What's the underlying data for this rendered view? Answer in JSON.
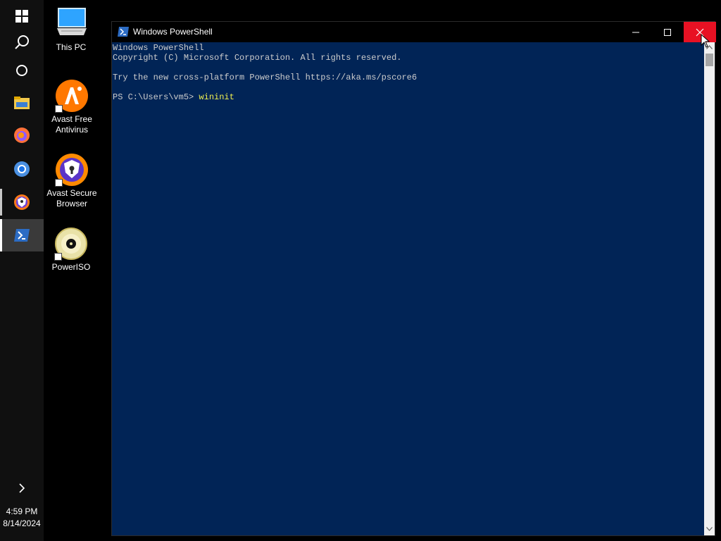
{
  "taskbar": {
    "items": [
      {
        "name": "start",
        "icon": "windows-logo-icon"
      },
      {
        "name": "search",
        "icon": "search-icon"
      },
      {
        "name": "cortana",
        "icon": "circle-icon"
      },
      {
        "name": "file-explorer",
        "icon": "folder-icon"
      },
      {
        "name": "firefox",
        "icon": "firefox-icon"
      },
      {
        "name": "chrome",
        "icon": "chrome-icon"
      },
      {
        "name": "avast-secure-browser",
        "icon": "avast-browser-icon"
      },
      {
        "name": "powershell",
        "icon": "powershell-icon"
      }
    ],
    "show_more_icon": "chevron-right-icon",
    "time": "4:59 PM",
    "date": "8/14/2024"
  },
  "desktop": {
    "icons": [
      {
        "label": "This PC",
        "icon": "computer-icon"
      },
      {
        "label": "Avast Free Antivirus",
        "icon": "avast-antivirus-icon"
      },
      {
        "label": "Avast Secure Browser",
        "icon": "avast-secure-browser-icon"
      },
      {
        "label": "PowerISO",
        "icon": "poweriso-icon"
      }
    ]
  },
  "window": {
    "title": "Windows PowerShell",
    "console_lines": [
      "Windows PowerShell",
      "Copyright (C) Microsoft Corporation. All rights reserved.",
      "",
      "Try the new cross-platform PowerShell https://aka.ms/pscore6",
      ""
    ],
    "prompt": "PS C:\\Users\\vm5> ",
    "command": "wininit"
  },
  "colors": {
    "console_bg": "#012456",
    "console_text": "#cccccc",
    "command_text": "#f0f050",
    "close_hover": "#e81123",
    "taskbar_bg": "#101010"
  }
}
